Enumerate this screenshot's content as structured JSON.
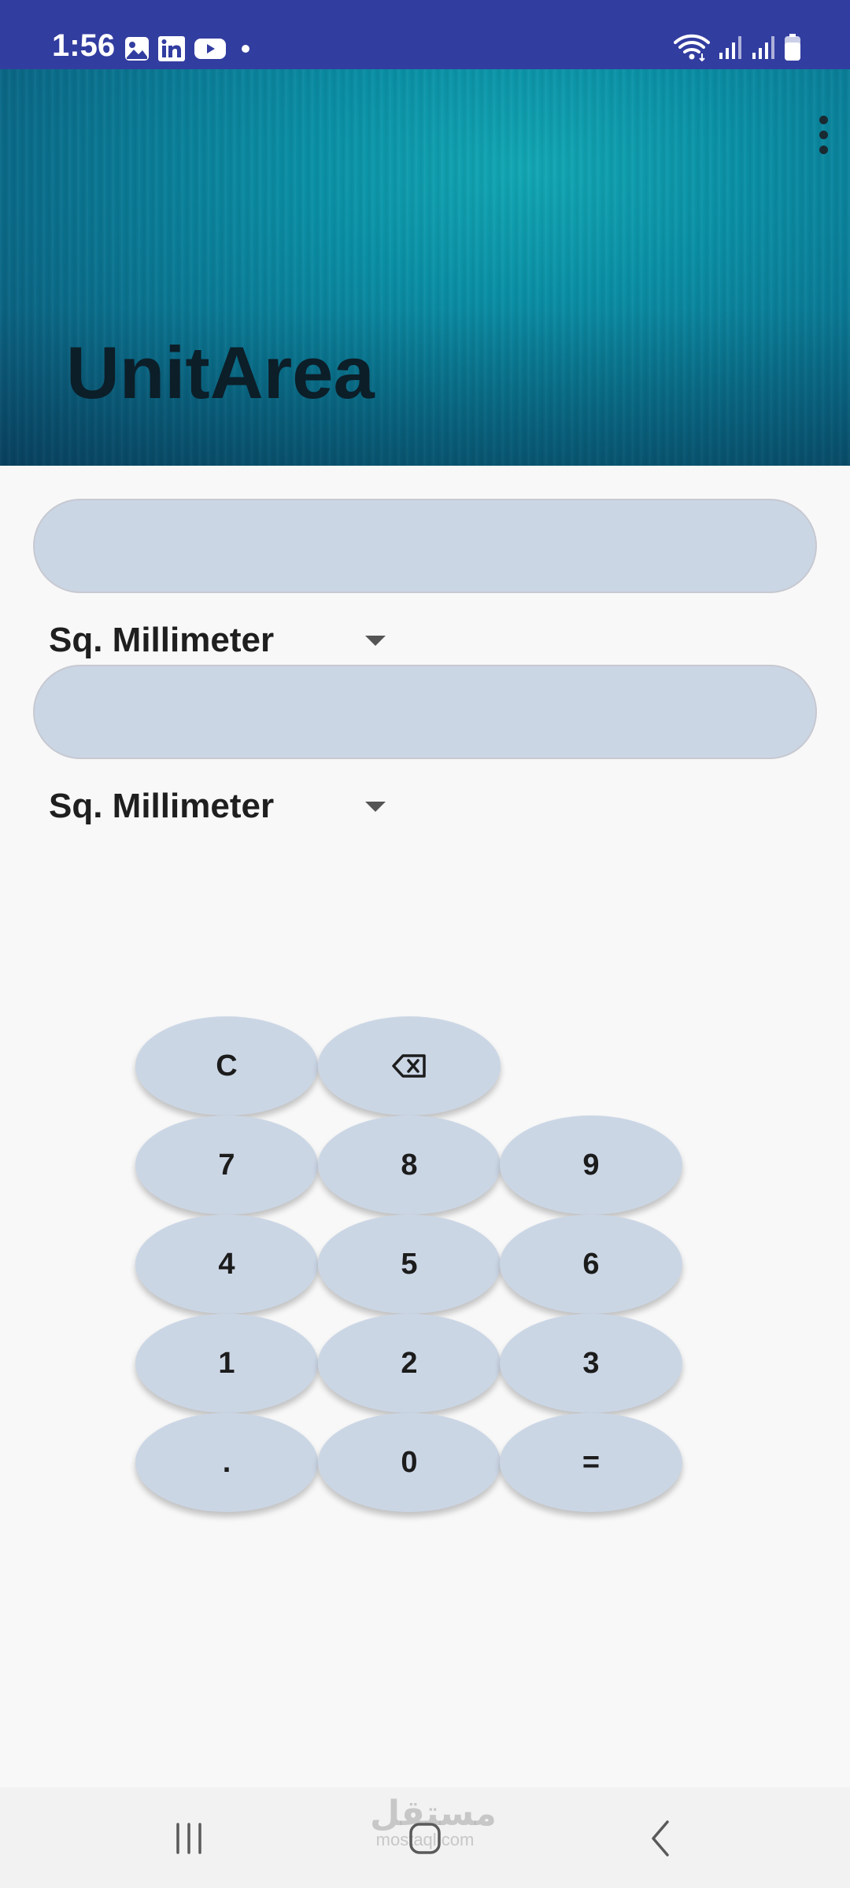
{
  "status_bar": {
    "time": "1:56",
    "left_icons": [
      "gallery-icon",
      "linkedin-icon",
      "youtube-icon",
      "dot-icon"
    ],
    "right_icons": [
      "wifi-icon",
      "signal-icon",
      "signal-icon",
      "battery-icon"
    ]
  },
  "header": {
    "title": "UnitArea",
    "menu_icon": "more-vert-icon"
  },
  "converter": {
    "input_value": "",
    "from_unit": "Sq. Millimeter",
    "output_value": "",
    "to_unit": "Sq. Millimeter"
  },
  "keypad": {
    "clear": "C",
    "backspace": "⌫",
    "k7": "7",
    "k8": "8",
    "k9": "9",
    "k4": "4",
    "k5": "5",
    "k6": "6",
    "k1": "1",
    "k2": "2",
    "k3": "3",
    "dot": ".",
    "k0": "0",
    "equals": "="
  },
  "nav_bar": {
    "watermark_logo": "مستقل",
    "watermark_text": "mostaql.com"
  },
  "colors": {
    "status_bar": "#323da0",
    "field_fill": "#cbd6e5",
    "background": "#f8f8f8",
    "title_text": "#0c1e28"
  }
}
